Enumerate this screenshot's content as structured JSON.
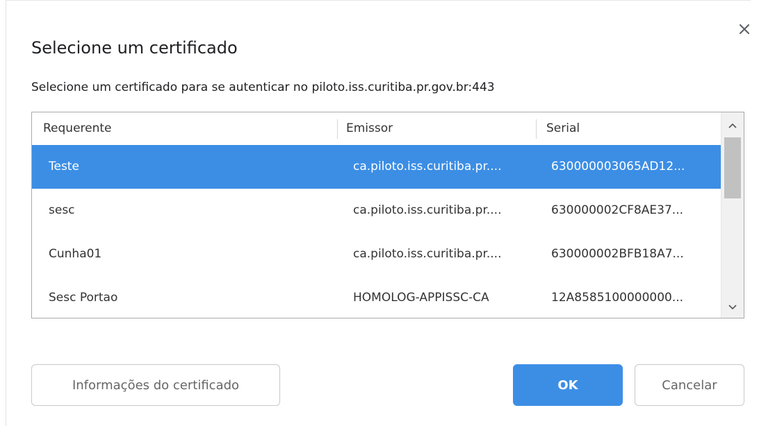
{
  "dialog": {
    "title": "Selecione um certificado",
    "subtitle": "Selecione um certificado para se autenticar no piloto.iss.curitiba.pr.gov.br:443",
    "close_icon": "close-icon"
  },
  "table": {
    "headers": {
      "requerente": "Requerente",
      "emissor": "Emissor",
      "serial": "Serial"
    },
    "rows": [
      {
        "requerente": "Teste",
        "emissor": "ca.piloto.iss.curitiba.pr....",
        "serial": "630000003065AD12...",
        "selected": true
      },
      {
        "requerente": "sesc",
        "emissor": "ca.piloto.iss.curitiba.pr....",
        "serial": "630000002CF8AE37...",
        "selected": false
      },
      {
        "requerente": "Cunha01",
        "emissor": "ca.piloto.iss.curitiba.pr....",
        "serial": "630000002BFB18A7...",
        "selected": false
      },
      {
        "requerente": "Sesc Portao",
        "emissor": "HOMOLOG-APPISSC-CA",
        "serial": "12A8585100000000...",
        "selected": false
      }
    ]
  },
  "buttons": {
    "info": "Informações do certificado",
    "ok": "OK",
    "cancel": "Cancelar"
  },
  "colors": {
    "accent": "#3c8ee5",
    "selected_text": "#ffffff"
  }
}
